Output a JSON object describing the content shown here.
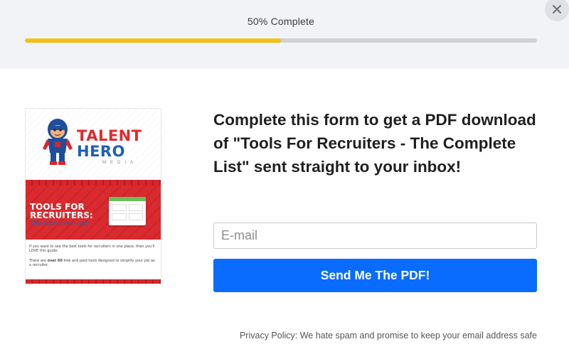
{
  "progress": {
    "label": "50% Complete",
    "percent": 50,
    "fill_color": "#f5bf14",
    "track_color": "#cfd1d4"
  },
  "close_button": {
    "icon": "close-icon"
  },
  "ebook_cover": {
    "brand_talent": "TALENT",
    "brand_hero": "HERO",
    "brand_media": "MEDIA",
    "title_line1": "TOOLS FOR",
    "title_line2": "RECRUITERS:",
    "subtitle": "The Complete List",
    "blurb_1": "If you want to see the best tools for recruiters in one place, then you'll LOVE this guide.",
    "blurb_2_before": "There are",
    "blurb_2_bold": "over 60",
    "blurb_2_after": "free and paid tools designed to simplify your job as a recruiter."
  },
  "form": {
    "headline": "Complete this form to get a PDF download of \"Tools For Recruiters - The Complete List\" sent straight to your inbox!",
    "email_placeholder": "E-mail",
    "email_value": "",
    "submit_label": "Send Me The PDF!",
    "privacy_text": "Privacy Policy: We hate spam and promise to keep your email address safe"
  },
  "colors": {
    "accent_blue": "#0a6cff",
    "brand_red": "#e02a2f",
    "brand_blue": "#1f5fb4",
    "top_band": "#f2f3f6"
  }
}
